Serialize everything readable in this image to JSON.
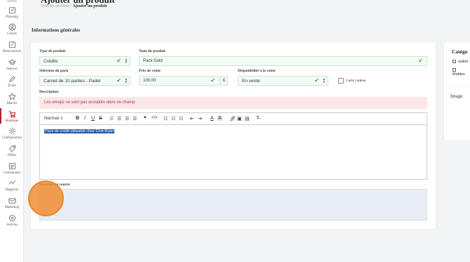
{
  "sidebar": {
    "items": [
      {
        "label": "Planning",
        "icon": "calendar-check-icon"
      },
      {
        "label": "Clients",
        "icon": "user-circle-icon"
      },
      {
        "label": "Réservations",
        "icon": "calendar-edit-icon"
      },
      {
        "label": "Séances",
        "icon": "graduation-cap-icon"
      },
      {
        "label": "École",
        "icon": "pencil-icon"
      },
      {
        "label": "Matchs",
        "icon": "star-icon"
      },
      {
        "label": "Boutique",
        "icon": "cart-icon"
      },
      {
        "label": "Configuration",
        "icon": "gear-icon"
      },
      {
        "label": "Offres",
        "icon": "tag-icon"
      },
      {
        "label": "Commandes",
        "icon": "list-icon"
      },
      {
        "label": "Rapports",
        "icon": "chart-line-icon"
      },
      {
        "label": "Marketing",
        "icon": "mail-icon"
      },
      {
        "label": "Articles",
        "icon": "settings-circle-icon"
      }
    ],
    "active": "Boutique",
    "accent_color": "#b3202a"
  },
  "header": {
    "title": "Ajouter un produit",
    "breadcrumb_parent": "Tous les produits /",
    "breadcrumb_current": "Ajouter un produit"
  },
  "section": {
    "title": "Informations générales"
  },
  "form": {
    "product_type": {
      "label": "Type de produit",
      "value": "Crédits"
    },
    "product_name": {
      "label": "Nom du produit",
      "value": "Pack Gold"
    },
    "pack_selection": {
      "label": "Sélection du pack",
      "value": "Carnet de 10 parties - Padel"
    },
    "sale_price": {
      "label": "Prix de vente",
      "value": "100,00",
      "currency": "€"
    },
    "availability": {
      "label": "Disponibilité à la vente",
      "value": "En vente"
    },
    "gift_card": {
      "label": "Carte cadeau",
      "checked": false
    },
    "description": {
      "label": "Description",
      "alert": "Les emojis ne sont pas acceptés dans ce champ",
      "toolbar": {
        "format": "Normal",
        "buttons": [
          "B",
          "I",
          "U",
          "S"
        ]
      },
      "content": "Pack de crédit utilisable chez Club Ryan"
    },
    "short_description": {
      "label": "Description courte",
      "value": ""
    }
  },
  "right_panel": {
    "categories_title": "Catégo",
    "options": [
      "wallet",
      "Mables"
    ],
    "image_title": "Image"
  },
  "colors": {
    "valid_green": "#2e9b4a",
    "alert_bg": "#fbe6e8",
    "alert_text": "#a33a44",
    "click_indicator": "#f08c32"
  }
}
